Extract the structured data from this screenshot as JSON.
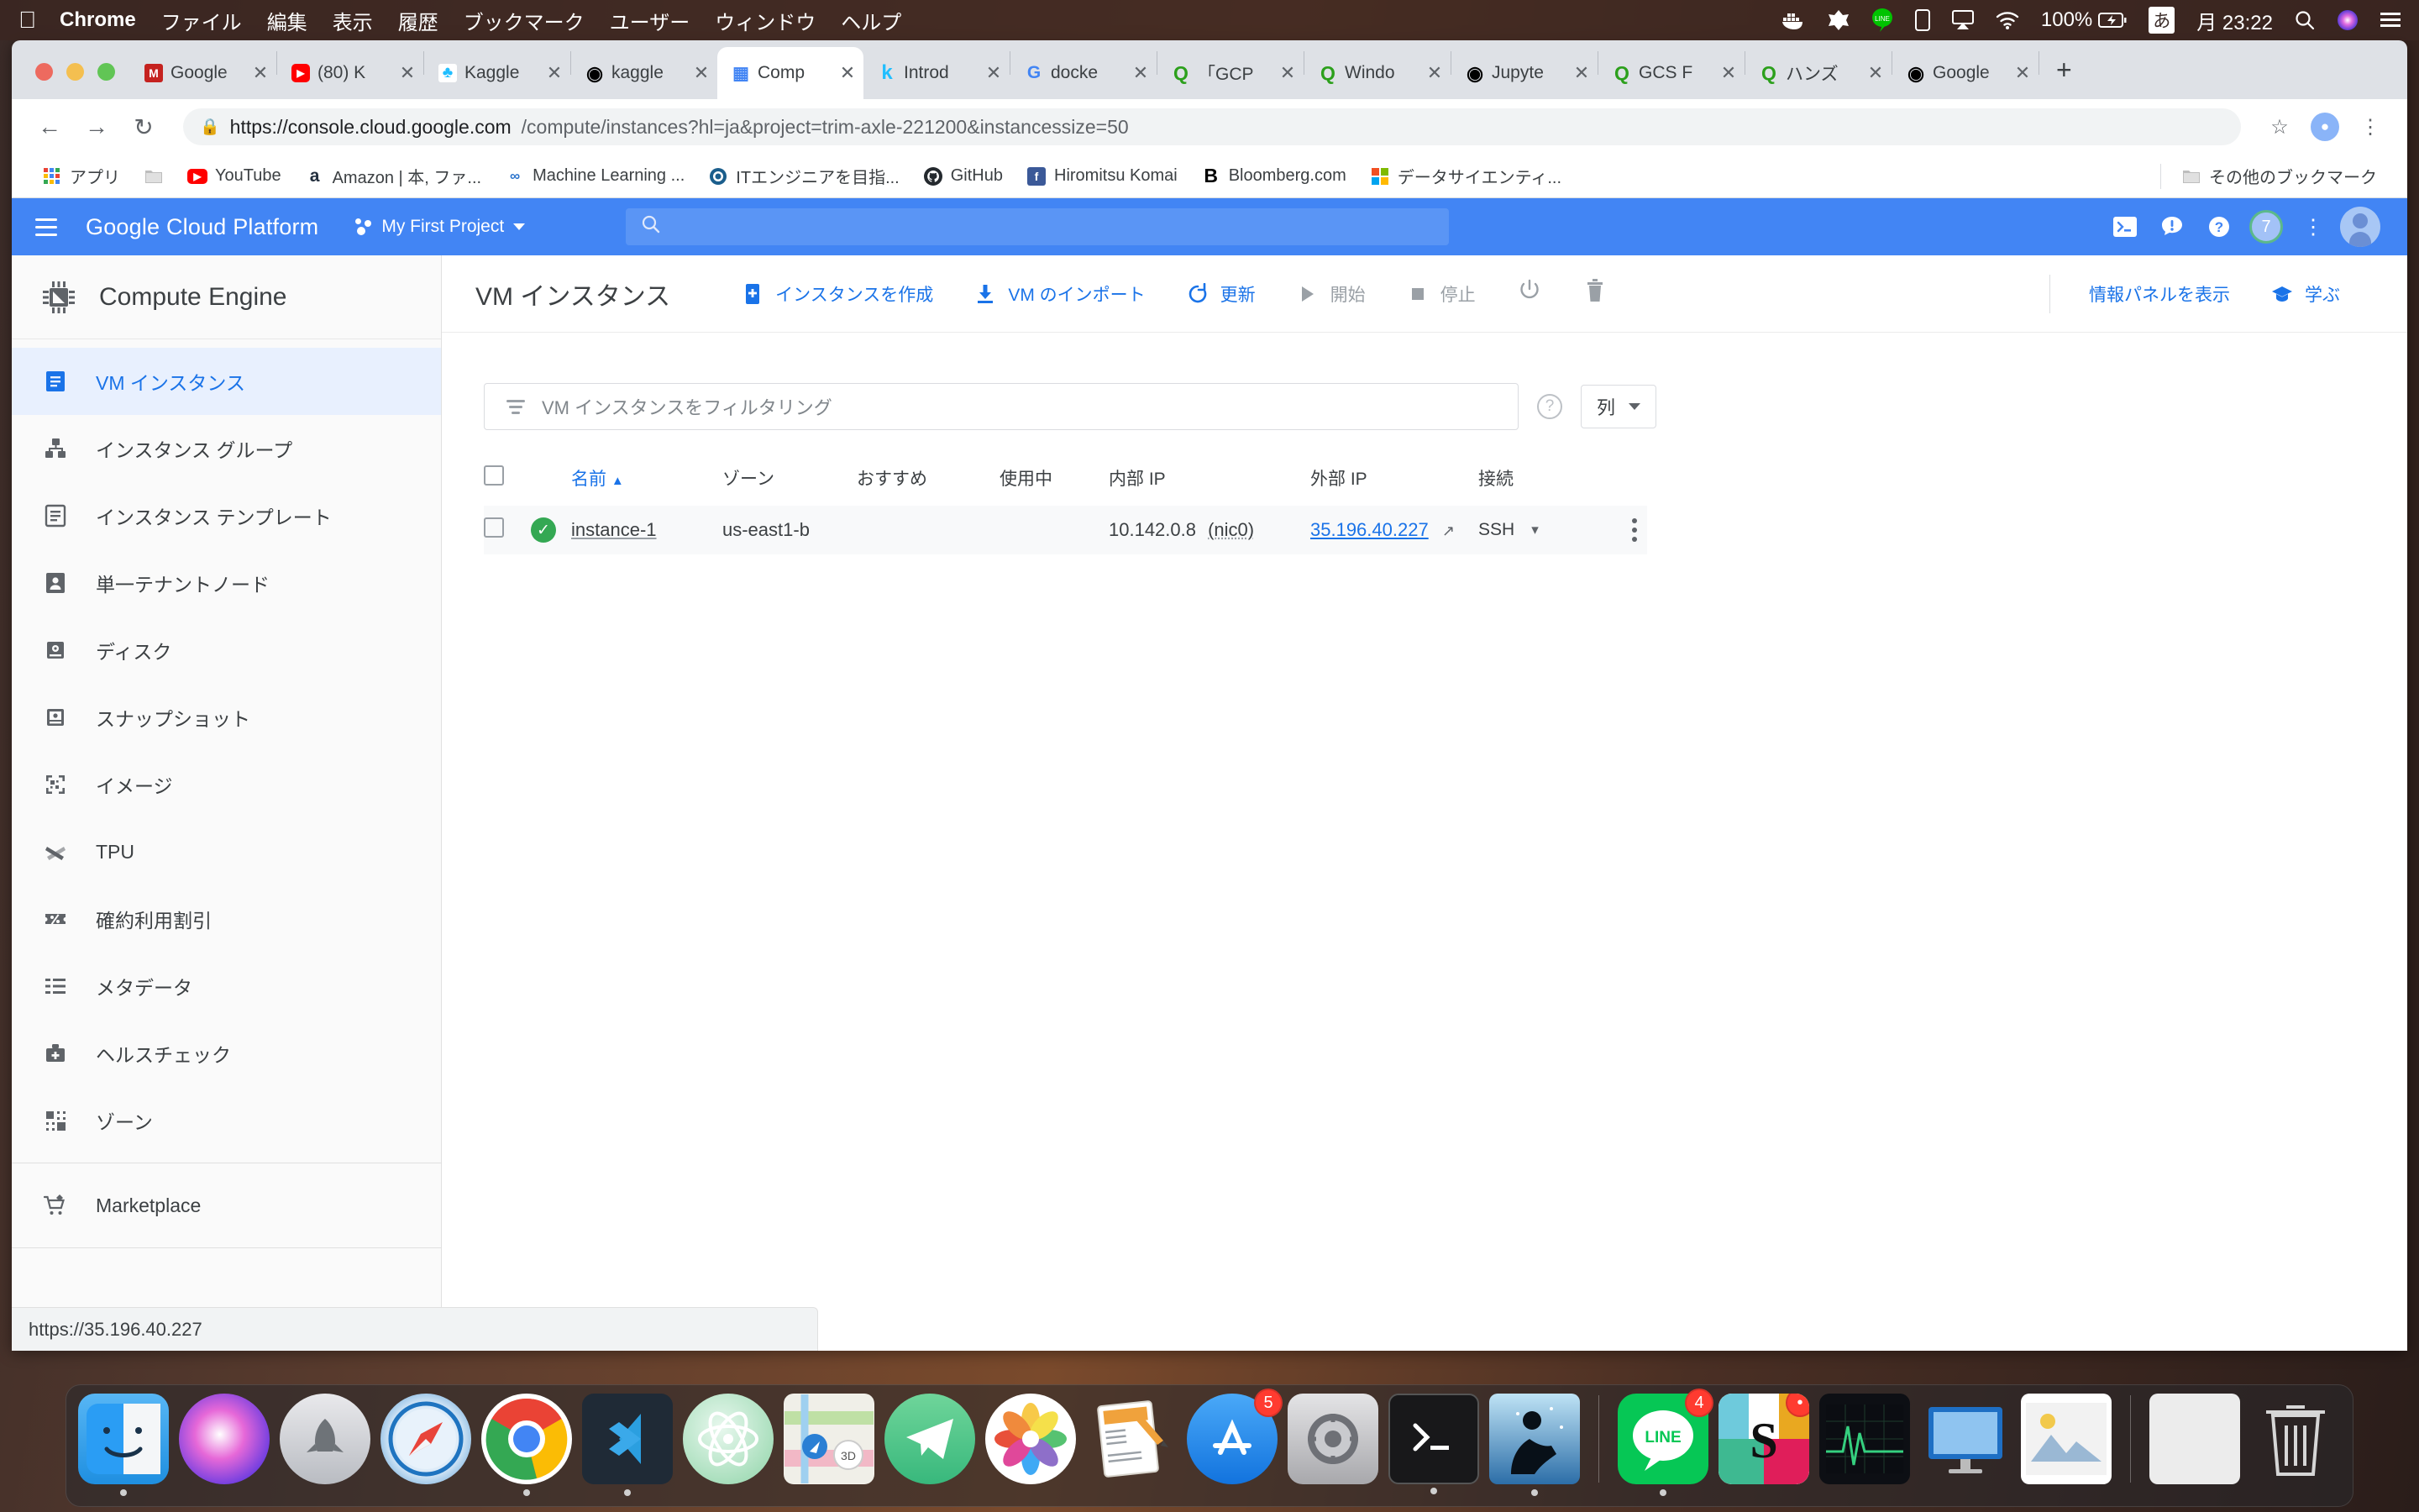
{
  "os_menubar": {
    "apple_icon": "apple-icon",
    "items": [
      {
        "label": "Chrome",
        "bold": true
      },
      {
        "label": "ファイル",
        "bold": false
      },
      {
        "label": "編集",
        "bold": false
      },
      {
        "label": "表示",
        "bold": false
      },
      {
        "label": "履歴",
        "bold": false
      },
      {
        "label": "ブックマーク",
        "bold": false
      },
      {
        "label": "ユーザー",
        "bold": false
      },
      {
        "label": "ウィンドウ",
        "bold": false
      },
      {
        "label": "ヘルプ",
        "bold": false
      }
    ],
    "status": {
      "docker": "docker-icon",
      "alpha": "alfred-icon",
      "line": "LINE",
      "phone": "phone-icon",
      "airplay": "airplay-icon",
      "wifi": "wifi-icon",
      "battery_percent": "100%",
      "battery_icon": "battery-charging-icon",
      "input_method": "あ",
      "clock": "月 23:22",
      "spotlight": "search-icon",
      "siri": "siri-icon",
      "notification_center": "list-icon"
    }
  },
  "browser": {
    "tabs": [
      {
        "title": "Google",
        "favicon": "gmail-icon",
        "active": false
      },
      {
        "title": "(80) K",
        "favicon": "youtube-icon",
        "active": false
      },
      {
        "title": "Kaggle",
        "favicon": "kaggle-icon",
        "active": false
      },
      {
        "title": "kaggle",
        "favicon": "circle-icon",
        "active": false
      },
      {
        "title": "Comp",
        "favicon": "chip-icon",
        "active": true
      },
      {
        "title": "Introd",
        "favicon": "kaggle-k-icon",
        "active": false
      },
      {
        "title": "docke",
        "favicon": "google-icon",
        "active": false
      },
      {
        "title": "「GCP",
        "favicon": "qiita-icon",
        "active": false
      },
      {
        "title": "Windo",
        "favicon": "qiita-icon",
        "active": false
      },
      {
        "title": "Jupyte",
        "favicon": "circle-icon",
        "active": false
      },
      {
        "title": "GCS F",
        "favicon": "qiita-icon",
        "active": false
      },
      {
        "title": "ハンズ",
        "favicon": "qiita-icon",
        "active": false
      },
      {
        "title": "Google",
        "favicon": "circle-icon",
        "active": false
      }
    ],
    "tab_close_label": "✕",
    "new_tab_label": "+",
    "nav": {
      "back": "back-arrow-icon",
      "forward": "forward-arrow-icon",
      "reload": "reload-icon",
      "star": "star-icon",
      "menu": "kebab-menu-icon"
    },
    "omnibox": {
      "lock": "lock-icon",
      "url_domain": "https://console.cloud.google.com",
      "url_path": "/compute/instances?hl=ja&project=trim-axle-221200&instancessize=50"
    },
    "profile_initial": "",
    "bookmarks": [
      {
        "label": "アプリ",
        "icon": "apps-grid-icon"
      },
      {
        "label": "",
        "icon": "folder-icon"
      },
      {
        "label": "YouTube",
        "icon": "youtube-icon"
      },
      {
        "label": "Amazon | 本, ファ...",
        "icon": "amazon-icon"
      },
      {
        "label": "Machine Learning ...",
        "icon": "coursera-icon"
      },
      {
        "label": "ITエンジニアを目指...",
        "icon": "blue-circle-icon"
      },
      {
        "label": "GitHub",
        "icon": "github-icon"
      },
      {
        "label": "Hiromitsu Komai",
        "icon": "facebook-icon"
      },
      {
        "label": "Bloomberg.com",
        "icon": "bloomberg-icon"
      },
      {
        "label": "データサイエンティ...",
        "icon": "microsoft-icon"
      }
    ],
    "other_bookmarks": {
      "label": "その他のブックマーク",
      "icon": "folder-icon"
    },
    "status_tooltip": "https://35.196.40.227"
  },
  "gcp_header": {
    "menu_icon": "hamburger-menu-icon",
    "title": "Google Cloud Platform",
    "project": "My First Project",
    "project_icon": "project-dots-icon",
    "search_placeholder": "",
    "search_icon": "search-icon",
    "actions": [
      {
        "name": "cloud-shell-icon"
      },
      {
        "name": "notifications-icon"
      },
      {
        "name": "help-icon"
      }
    ],
    "badge_count": "7",
    "more_icon": "kebab-menu-icon",
    "avatar": "user-avatar"
  },
  "sidebar": {
    "product_title": "Compute Engine",
    "product_icon": "chip-icon",
    "items": [
      {
        "label": "VM インスタンス",
        "icon": "vm-instance-icon",
        "active": true
      },
      {
        "label": "インスタンス グループ",
        "icon": "instance-group-icon",
        "active": false
      },
      {
        "label": "インスタンス テンプレート",
        "icon": "instance-template-icon",
        "active": false
      },
      {
        "label": "単一テナントノード",
        "icon": "sole-tenant-node-icon",
        "active": false
      },
      {
        "label": "ディスク",
        "icon": "disk-icon",
        "active": false
      },
      {
        "label": "スナップショット",
        "icon": "snapshot-icon",
        "active": false
      },
      {
        "label": "イメージ",
        "icon": "image-icon",
        "active": false
      },
      {
        "label": "TPU",
        "icon": "tpu-icon",
        "active": false
      },
      {
        "label": "確約利用割引",
        "icon": "percent-icon",
        "active": false
      },
      {
        "label": "メタデータ",
        "icon": "metadata-icon",
        "active": false
      },
      {
        "label": "ヘルスチェック",
        "icon": "health-check-icon",
        "active": false
      },
      {
        "label": "ゾーン",
        "icon": "zone-icon",
        "active": false
      }
    ],
    "marketplace": {
      "label": "Marketplace",
      "icon": "cart-icon"
    },
    "collapse_icon": "collapse-panel-icon"
  },
  "main": {
    "title": "VM インスタンス",
    "toolbar": [
      {
        "label": "インスタンスを作成",
        "icon": "create-instance-icon",
        "disabled": false
      },
      {
        "label": "VM のインポート",
        "icon": "import-vm-icon",
        "disabled": false
      },
      {
        "label": "更新",
        "icon": "refresh-icon",
        "disabled": false
      },
      {
        "label": "開始",
        "icon": "play-icon",
        "disabled": true
      },
      {
        "label": "停止",
        "icon": "stop-icon",
        "disabled": true
      }
    ],
    "icon_buttons": [
      {
        "name": "reset-icon"
      },
      {
        "name": "trash-icon"
      }
    ],
    "right_actions": [
      {
        "label": "情報パネルを表示",
        "icon": ""
      },
      {
        "label": "学ぶ",
        "icon": "learn-icon"
      }
    ],
    "filter": {
      "icon": "filter-icon",
      "placeholder": "VM インスタンスをフィルタリング",
      "value": "",
      "help_icon": "help-icon",
      "columns_label": "列"
    },
    "table": {
      "headers": [
        "名前",
        "ゾーン",
        "おすすめ",
        "使用中",
        "内部 IP",
        "外部 IP",
        "接続"
      ],
      "sort_column": "名前",
      "sort_direction": "▲",
      "rows": [
        {
          "status": "running",
          "status_icon": "check-circle-icon",
          "name": "instance-1",
          "zone": "us-east1-b",
          "recommendation": "",
          "in_use_by": "",
          "internal_ip": "10.142.0.8",
          "internal_ip_nic": "(nic0)",
          "external_ip": "35.196.40.227",
          "external_ip_icon": "external-link-icon",
          "connect": "SSH",
          "connect_caret": "▾",
          "row_menu": "kebab-menu-icon"
        }
      ]
    }
  },
  "dock": {
    "items": [
      {
        "name": "finder",
        "running": true,
        "badge": ""
      },
      {
        "name": "siri",
        "running": false,
        "badge": ""
      },
      {
        "name": "launchpad",
        "running": false,
        "badge": ""
      },
      {
        "name": "safari",
        "running": false,
        "badge": ""
      },
      {
        "name": "chrome",
        "running": true,
        "badge": ""
      },
      {
        "name": "vscode",
        "running": true,
        "badge": ""
      },
      {
        "name": "atom",
        "running": false,
        "badge": ""
      },
      {
        "name": "maps",
        "running": false,
        "badge": ""
      },
      {
        "name": "telegram",
        "running": false,
        "badge": ""
      },
      {
        "name": "photos",
        "running": false,
        "badge": ""
      },
      {
        "name": "pages",
        "running": false,
        "badge": ""
      },
      {
        "name": "app-store",
        "running": false,
        "badge": "5"
      },
      {
        "name": "system-preferences",
        "running": false,
        "badge": ""
      },
      {
        "name": "terminal",
        "running": true,
        "badge": ""
      },
      {
        "name": "kindle",
        "running": true,
        "badge": ""
      },
      {
        "name": "line",
        "running": true,
        "badge": "4"
      },
      {
        "name": "slack",
        "running": true,
        "badge": "•"
      },
      {
        "name": "activity-monitor",
        "running": false,
        "badge": ""
      },
      {
        "name": "keynote",
        "running": false,
        "badge": ""
      },
      {
        "name": "preview",
        "running": false,
        "badge": ""
      },
      {
        "name": "downloads",
        "running": false,
        "badge": ""
      },
      {
        "name": "trash",
        "running": false,
        "badge": ""
      }
    ]
  }
}
